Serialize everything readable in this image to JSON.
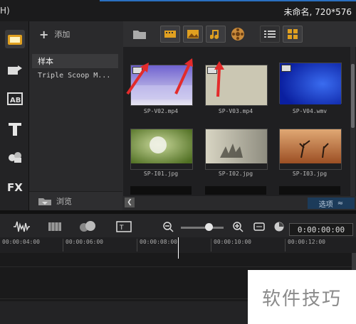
{
  "titlebar": {
    "left_text": "H)",
    "project_info": "未命名, 720*576"
  },
  "library": {
    "add_label": "添加",
    "items": [
      {
        "label": "样本"
      },
      {
        "label": "Triple Scoop M..."
      }
    ],
    "browse_label": "浏览"
  },
  "media": {
    "items": [
      {
        "caption": "SP-V02.mp4",
        "type": "video",
        "color": "#5b4fb8"
      },
      {
        "caption": "SP-V03.mp4",
        "type": "video",
        "color": "#cfcab6"
      },
      {
        "caption": "SP-V04.wmv",
        "type": "video",
        "color": "#1a3fc8"
      },
      {
        "caption": "SP-I01.jpg",
        "type": "image",
        "color": "#7aa04a"
      },
      {
        "caption": "SP-I02.jpg",
        "type": "image",
        "color": "#b8b5a5"
      },
      {
        "caption": "SP-I03.jpg",
        "type": "image",
        "color": "#c9844e"
      }
    ],
    "options_label": "选项",
    "options_glyph": "≈"
  },
  "timeline": {
    "timecode": "0:00:00:00",
    "ruler": [
      "00:00:04:00",
      "00:00:06:00",
      "00:00:08:00",
      "00:00:10:00",
      "00:00:12:00"
    ]
  },
  "watermark": "软件技巧"
}
